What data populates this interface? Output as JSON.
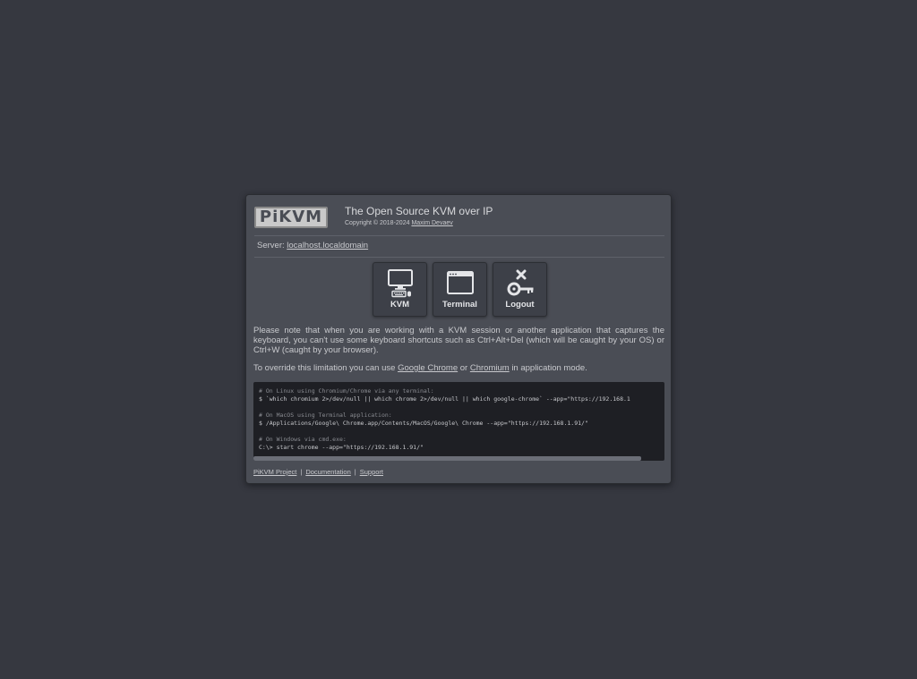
{
  "header": {
    "logo_text": "PiKVM",
    "title": "The Open Source KVM over IP",
    "copyright_prefix": "Copyright © 2018-2024",
    "author": "Maxim Devaev"
  },
  "server": {
    "label": "Server:",
    "hostname": "localhost.localdomain"
  },
  "apps": [
    {
      "label": "KVM",
      "icon": "monitor-keyboard-icon"
    },
    {
      "label": "Terminal",
      "icon": "terminal-window-icon"
    },
    {
      "label": "Logout",
      "icon": "key-cross-icon"
    }
  ],
  "note": {
    "paragraph1": "Please note that when you are working with a KVM session or another application that captures the keyboard, you can't use some keyboard shortcuts such as Ctrl+Alt+Del (which will be caught by your OS) or Ctrl+W (caught by your browser).",
    "p2_before": "To override this limitation you can use",
    "link_chrome": "Google Chrome",
    "p2_or": "or",
    "link_chromium": "Chromium",
    "p2_after": "in application mode."
  },
  "code": {
    "linux_comment": "# On Linux using Chromium/Chrome via any terminal:",
    "linux_cmd": "$ `which chromium 2>/dev/null || which chrome 2>/dev/null || which google-chrome` --app=\"https://192.168.1",
    "mac_comment": "# On MacOS using Terminal application:",
    "mac_cmd": "$ /Applications/Google\\ Chrome.app/Contents/MacOS/Google\\ Chrome --app=\"https://192.168.1.91/\"",
    "win_comment": "# On Windows via cmd.exe:",
    "win_cmd": "C:\\> start chrome --app=\"https://192.168.1.91/\""
  },
  "footer": {
    "links": [
      "PiKVM Project",
      "Documentation",
      "Support"
    ],
    "separator": "|"
  },
  "colors": {
    "background": "#363840",
    "window": "#4a4d55",
    "button": "#3d4048",
    "code_bg": "#1e1f24"
  }
}
